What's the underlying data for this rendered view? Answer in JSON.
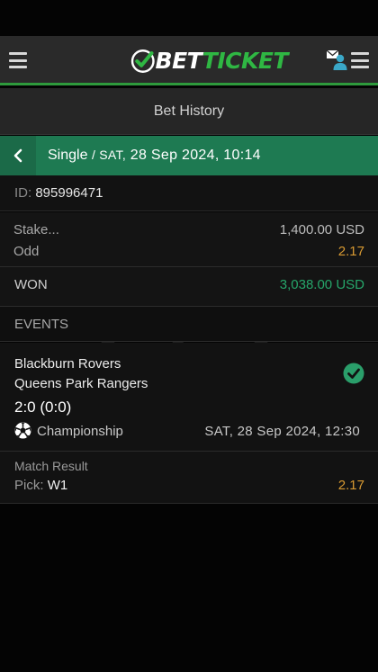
{
  "brand": {
    "logo_part1": "BET",
    "logo_part2": "TICKET"
  },
  "header": {
    "title": "Bet History"
  },
  "bet": {
    "type": "Single",
    "separator": "/",
    "date_day": "SAT,",
    "date": "28 Sep 2024, 10:14",
    "id_label": "ID:",
    "id_value": "895996471",
    "stake_label": "Stake...",
    "stake_value": "1,400.00 USD",
    "odd_label": "Odd",
    "odd_value": "2.17",
    "status_label": "WON",
    "won_value": "3,038.00 USD"
  },
  "events": {
    "heading": "EVENTS",
    "items": [
      {
        "home": "Blackburn Rovers",
        "away": "Queens Park Rangers",
        "score": "2:0 (0:0)",
        "league": "Championship",
        "date": "SAT, 28 Sep 2024, 12:30",
        "market": "Match Result",
        "pick_label": "Pick:",
        "pick_value": "W1",
        "odd": "2.17"
      }
    ]
  },
  "colors": {
    "accent_green": "#2e9a3c",
    "bar_green": "#1e7a52",
    "odd_orange": "#d89a32",
    "won_green": "#26a66a",
    "check_green": "#2a9e6a"
  },
  "icons": {
    "menu_left": "hamburger-menu-icon",
    "menu_right": "hamburger-menu-icon",
    "messages": "mail-user-icon",
    "back": "chevron-left-icon",
    "status": "check-circle-icon",
    "sport": "soccer-ball-icon"
  }
}
